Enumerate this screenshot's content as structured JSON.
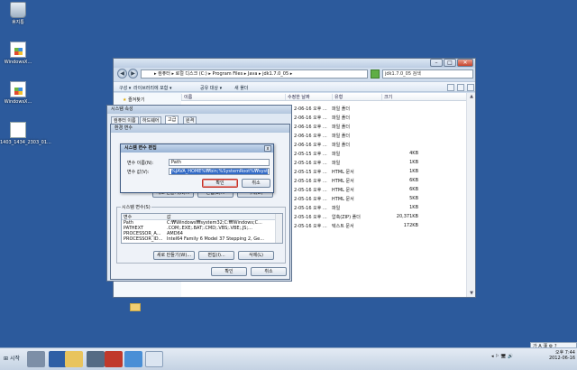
{
  "desktop": {
    "icons": [
      {
        "label": "휴지통",
        "icon": "recycle-bin-icon"
      },
      {
        "label": "WindowsX...",
        "icon": "windows-image-icon"
      },
      {
        "label": "WindowsX...",
        "icon": "windows-image-icon"
      },
      {
        "label": "1403_1434_2303_01...",
        "icon": "document-icon"
      }
    ]
  },
  "explorer": {
    "breadcrumb": "▸ 컴퓨터 ▸ 로컬 디스크 (C:) ▸ Program Files ▸ Java ▸ jdk1.7.0_05 ▸",
    "search_placeholder": "jdk1.7.0_05 검색",
    "toolbar": {
      "organize": "구성 ▾",
      "include_library": "라이브러리에 포함 ▾",
      "share": "공유 대상 ▾",
      "new_folder": "새 폴더"
    },
    "favorites": "즐겨찾기",
    "columns": {
      "name": "이름",
      "modified": "수정한 날짜",
      "type": "유형",
      "size": "크기"
    },
    "files": [
      {
        "date": "2-06-16 오후 ...",
        "type": "파일 폴더",
        "size": ""
      },
      {
        "date": "2-06-16 오후 ...",
        "type": "파일 폴더",
        "size": ""
      },
      {
        "date": "2-06-16 오후 ...",
        "type": "파일 폴더",
        "size": ""
      },
      {
        "date": "2-06-16 오후 ...",
        "type": "파일 폴더",
        "size": ""
      },
      {
        "date": "2-06-16 오후 ...",
        "type": "파일 폴더",
        "size": ""
      },
      {
        "date": "2-05-15 오후 ...",
        "type": "파일",
        "size": "4KB"
      },
      {
        "date": "2-05-16 오후 ...",
        "type": "파일",
        "size": "1KB"
      },
      {
        "date": "2-05-15 오후 ...",
        "type": "HTML 문서",
        "size": "1KB"
      },
      {
        "date": "2-05-16 오후 ...",
        "type": "HTML 문서",
        "size": "6KB"
      },
      {
        "date": "2-05-16 오후 ...",
        "type": "HTML 문서",
        "size": "6KB"
      },
      {
        "date": "2-05-16 오후 ...",
        "type": "HTML 문서",
        "size": "5KB"
      },
      {
        "date": "2-05-16 오후 ...",
        "type": "파일",
        "size": "1KB"
      },
      {
        "date": "2-05-16 오후 ...",
        "type": "압축(ZIP) 폴더",
        "size": "20,371KB"
      },
      {
        "date": "2-05-16 오후 ...",
        "type": "텍스트 문서",
        "size": "172KB"
      }
    ]
  },
  "system_properties": {
    "title": "시스템 속성",
    "tabs": [
      "컴퓨터 이름",
      "하드웨어",
      "고급",
      "원격"
    ]
  },
  "env_vars": {
    "title": "환경 변수",
    "system_group_label": "시스템 변수(S)",
    "user_new_label": "새로 만들기(N)...",
    "user_edit_label": "편집(E)...",
    "user_delete_label": "삭제(D)",
    "sysvar_columns": {
      "var": "변수",
      "value": "값"
    },
    "sysvars": [
      {
        "name": "Path",
        "value": "C:₩Windows₩system32;C:₩Windows;C..."
      },
      {
        "name": "PATHEXT",
        "value": ".COM;.EXE;.BAT;.CMD;.VBS;.VBE;.JS;..."
      },
      {
        "name": "PROCESSOR_A...",
        "value": "AMD64"
      },
      {
        "name": "PROCESSOR_ID...",
        "value": "Intel64 Family 6 Model 37 Stepping 2, Ge..."
      }
    ],
    "sys_new_label": "새로 만들기(W)...",
    "sys_edit_label": "편집(I)...",
    "sys_delete_label": "삭제(L)",
    "ok_label": "확인",
    "cancel_label": "취소"
  },
  "edit_variable": {
    "title": "시스템 변수 편집",
    "close_label": "x",
    "name_label": "변수 이름(N):",
    "name_value": "Path",
    "value_label": "변수 값(V):",
    "value_value": "%JAVA_HOME%₩bin;%SystemRoot%₩syst",
    "ok_label": "확인",
    "cancel_label": "취소"
  },
  "taskbar": {
    "start_label": "시작",
    "ime": "가 A 漢 ⚙ ?",
    "clock_time": "오후 7:44",
    "clock_date": "2012-06-16"
  },
  "colors": {
    "desktop": "#2c5a9c",
    "selection": "#3169c6",
    "focus_border": "#c2312b"
  }
}
